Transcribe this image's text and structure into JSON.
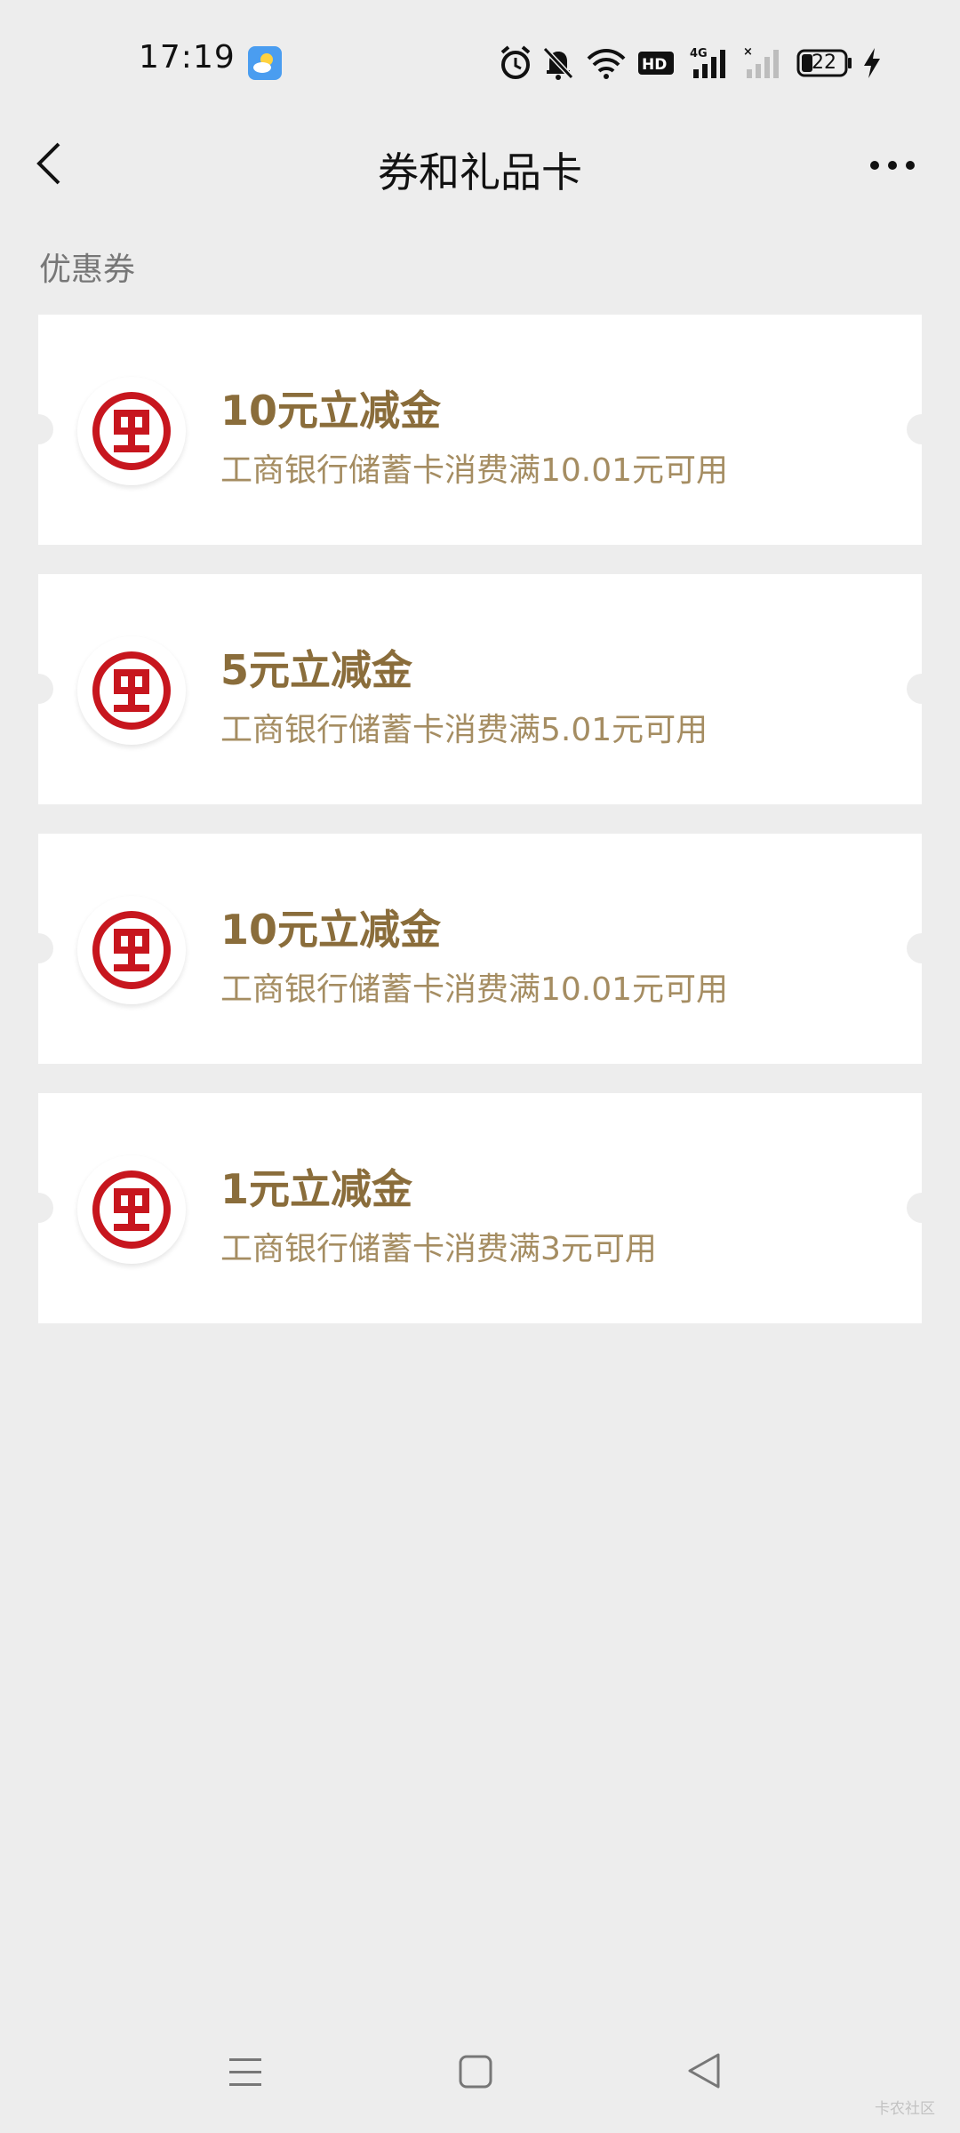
{
  "status_bar": {
    "time": "17:19",
    "battery_level": "22",
    "icons": [
      "weather-icon",
      "alarm-icon",
      "mute-bell-icon",
      "wifi-icon",
      "hd-icon",
      "signal-4g-icon",
      "signal-no-service-icon",
      "battery-icon",
      "charging-icon"
    ]
  },
  "nav": {
    "title": "券和礼品卡",
    "back_icon": "chevron-left-icon",
    "more_icon": "more-dots-icon"
  },
  "section": {
    "label": "优惠券"
  },
  "coupons": [
    {
      "title": "10元立减金",
      "desc": "工商银行储蓄卡消费满10.01元可用",
      "logo": "icbc-logo-icon"
    },
    {
      "title": "5元立减金",
      "desc": "工商银行储蓄卡消费满5.01元可用",
      "logo": "icbc-logo-icon"
    },
    {
      "title": "10元立减金",
      "desc": "工商银行储蓄卡消费满10.01元可用",
      "logo": "icbc-logo-icon"
    },
    {
      "title": "1元立减金",
      "desc": "工商银行储蓄卡消费满3元可用",
      "logo": "icbc-logo-icon"
    }
  ],
  "system_nav": {
    "icons": [
      "menu-icon",
      "home-square-icon",
      "back-triangle-icon"
    ]
  },
  "watermark": "卡农社区",
  "colors": {
    "background": "#ededed",
    "card": "#ffffff",
    "coupon_title": "#8a6d3b",
    "coupon_desc": "#a58d62",
    "icbc_red": "#c7161e"
  }
}
